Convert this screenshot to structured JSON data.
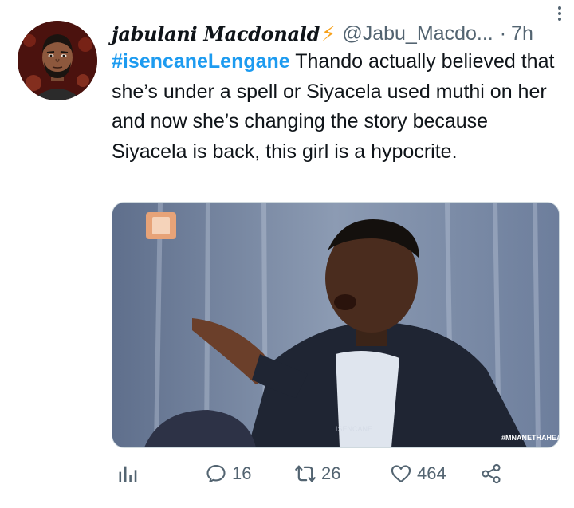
{
  "tweet": {
    "display_name": "jabulani Macdonald",
    "badge_icon": "lightning-bolt-icon",
    "handle": "@Jabu_Macdo...",
    "separator": "·",
    "time": "7h",
    "hashtag": "#isencaneLengane",
    "body": " Thando actually believed that she’s under a spell or Siyacela used muthi on her and now she’s changing the story because Siyacela is back, this girl is a hypocrite.",
    "media": {
      "watermark": "#MNANETHAHEA",
      "logo": "ISENCANE"
    },
    "actions": {
      "analytics_icon": "bar-chart-icon",
      "replies": "16",
      "retweets": "26",
      "likes": "464",
      "share_icon": "share-icon"
    }
  },
  "colors": {
    "accent": "#1d9bf0",
    "secondary_text": "#536471",
    "bolt": "#f7a11a"
  }
}
